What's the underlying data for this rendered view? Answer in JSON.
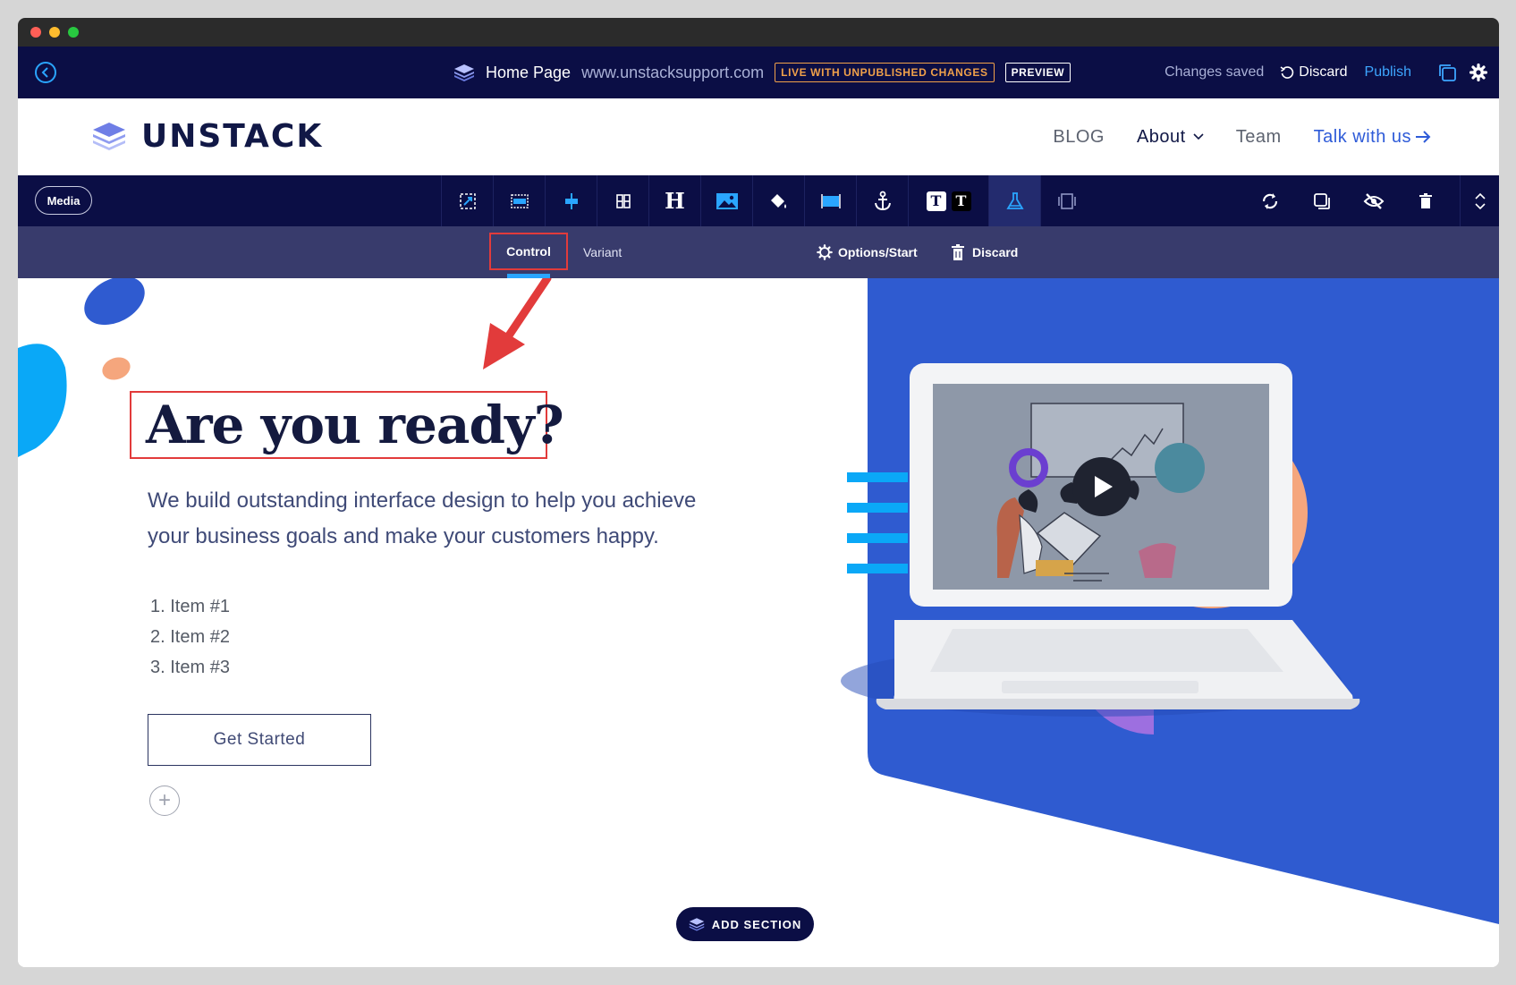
{
  "window": {
    "traffic_lights": [
      "#ff5f57",
      "#febc2e",
      "#28c840"
    ]
  },
  "editor_bar": {
    "page_name": "Home Page",
    "site_url": "www.unstacksupport.com",
    "live_badge": "LIVE WITH UNPUBLISHED CHANGES",
    "preview_badge": "PREVIEW",
    "status": "Changes saved",
    "discard": "Discard",
    "publish": "Publish"
  },
  "site_nav": {
    "logo_text": "UNSTACK",
    "links": [
      "BLOG",
      "About",
      "Team",
      "Talk with us"
    ]
  },
  "section_toolbar": {
    "media_label": "Media",
    "tools": [
      "selection-icon",
      "full-width-icon",
      "align-center-icon",
      "columns-icon",
      "heading-icon",
      "image-icon",
      "paint-bucket-icon",
      "layout-block-icon",
      "anchor-icon",
      "text-style-icon",
      "ab-test-icon",
      "device-view-icon"
    ],
    "heading_glyph": "H",
    "text_glyph": "T"
  },
  "sub_bar": {
    "control": "Control",
    "variant": "Variant",
    "options": "Options/Start",
    "discard": "Discard"
  },
  "hero": {
    "headline": "Are you ready?",
    "subtext": "We build outstanding interface design to help you achieve your business goals and make your customers happy.",
    "list_items": [
      "1. Item #1",
      "2. Item #2",
      "3. Item #3"
    ],
    "cta": "Get Started",
    "add_block": "+"
  },
  "add_section": "ADD SECTION",
  "colors": {
    "editor_navy": "#0b0e45",
    "sub_bar": "#383b6c",
    "accent_blue": "#2aa5ff",
    "hero_blue": "#2f5bd0",
    "annotation_red": "#e23b3b",
    "warning_orange": "#f0a14a"
  }
}
